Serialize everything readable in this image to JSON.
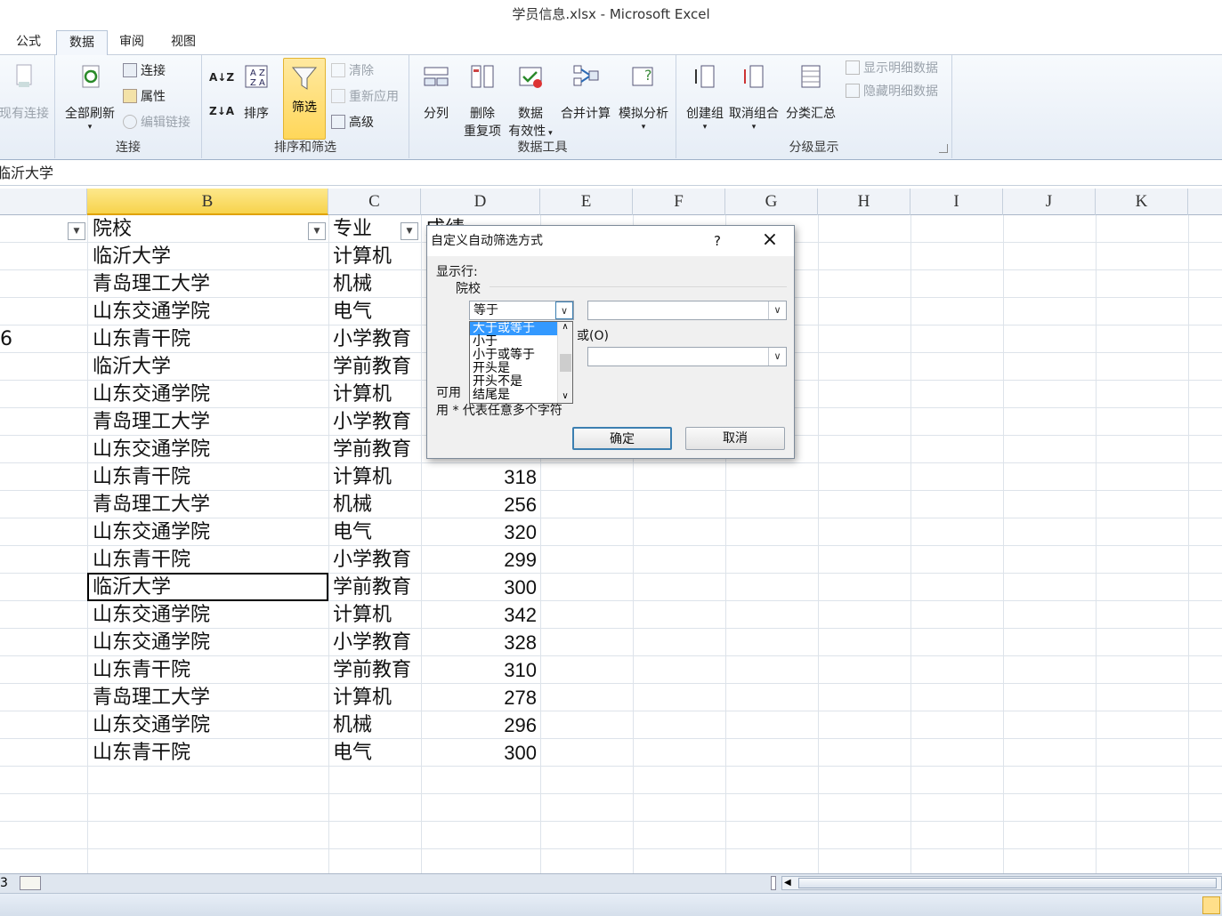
{
  "window": {
    "title": "学员信息.xlsx - Microsoft Excel"
  },
  "tabs": [
    {
      "label": "公式"
    },
    {
      "label": "数据",
      "active": true
    },
    {
      "label": "审阅"
    },
    {
      "label": "视图"
    }
  ],
  "ribbon": {
    "existing_connections": "现有连接",
    "refresh_all": "全部刷新",
    "connections": "连接",
    "properties": "属性",
    "edit_links": "编辑链接",
    "group_connections": "连接",
    "sort_az": "A↓Z",
    "sort_za": "Z↓A",
    "sort": "排序",
    "filter": "筛选",
    "clear": "清除",
    "reapply": "重新应用",
    "advanced": "高级",
    "group_sort_filter": "排序和筛选",
    "text_to_columns": "分列",
    "remove_dup_1": "删除",
    "remove_dup_2": "重复项",
    "validation_1": "数据",
    "validation_2": "有效性",
    "consolidate": "合并计算",
    "whatif": "模拟分析",
    "group_data_tools": "数据工具",
    "group_btn": "创建组",
    "ungroup_btn": "取消组合",
    "subtotal": "分类汇总",
    "show_detail": "显示明细数据",
    "hide_detail": "隐藏明细数据",
    "group_outline": "分级显示"
  },
  "formula_bar": {
    "value": "临沂大学"
  },
  "columns": [
    "B",
    "C",
    "D",
    "E",
    "F",
    "G",
    "H",
    "I",
    "J",
    "K"
  ],
  "header_row": {
    "b": "院校",
    "c": "专业",
    "d": "成绩"
  },
  "partial_a_value": "6",
  "rows": [
    {
      "b": "临沂大学",
      "c": "计算机",
      "d": ""
    },
    {
      "b": "青岛理工大学",
      "c": "机械",
      "d": ""
    },
    {
      "b": "山东交通学院",
      "c": "电气",
      "d": ""
    },
    {
      "b": "山东青干院",
      "c": "小学教育",
      "d": ""
    },
    {
      "b": "临沂大学",
      "c": "学前教育",
      "d": ""
    },
    {
      "b": "山东交通学院",
      "c": "计算机",
      "d": ""
    },
    {
      "b": "青岛理工大学",
      "c": "小学教育",
      "d": ""
    },
    {
      "b": "山东交通学院",
      "c": "学前教育",
      "d": ""
    },
    {
      "b": "山东青干院",
      "c": "计算机",
      "d": "318"
    },
    {
      "b": "青岛理工大学",
      "c": "机械",
      "d": "256"
    },
    {
      "b": "山东交通学院",
      "c": "电气",
      "d": "320"
    },
    {
      "b": "山东青干院",
      "c": "小学教育",
      "d": "299"
    },
    {
      "b": "临沂大学",
      "c": "学前教育",
      "d": "300"
    },
    {
      "b": "山东交通学院",
      "c": "计算机",
      "d": "342"
    },
    {
      "b": "山东交通学院",
      "c": "小学教育",
      "d": "328"
    },
    {
      "b": "山东青干院",
      "c": "学前教育",
      "d": "310"
    },
    {
      "b": "青岛理工大学",
      "c": "计算机",
      "d": "278"
    },
    {
      "b": "山东交通学院",
      "c": "机械",
      "d": "296"
    },
    {
      "b": "山东青干院",
      "c": "电气",
      "d": "300"
    }
  ],
  "sheet_tabs": {
    "partial": "3"
  },
  "dialog": {
    "title": "自定义自动筛选方式",
    "help": "?",
    "show_rows": "显示行:",
    "field": "院校",
    "op1_value": "等于",
    "or_label": "或(O)",
    "hint1": "可用",
    "hint2": "用 * 代表任意多个字符",
    "ok": "确定",
    "cancel": "取消",
    "dropdown_options": [
      "大于或等于",
      "小于",
      "小于或等于",
      "开头是",
      "开头不是",
      "结尾是"
    ]
  }
}
